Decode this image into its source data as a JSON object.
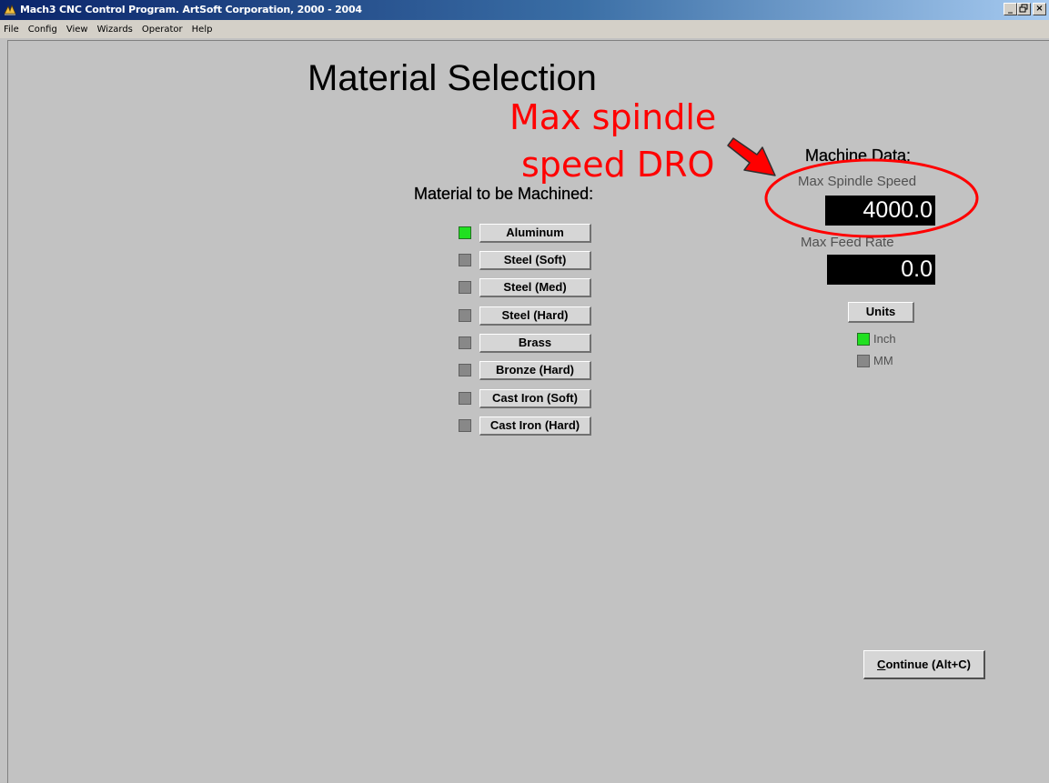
{
  "window": {
    "title": "Mach3 CNC Control Program. ArtSoft Corporation, 2000 - 2004",
    "controls": {
      "minimize": "_",
      "maximize": " ",
      "close": "×"
    }
  },
  "menu": [
    "File",
    "Config",
    "View",
    "Wizards",
    "Operator",
    "Help"
  ],
  "page": {
    "title": "Material Selection"
  },
  "materials": {
    "header": "Material to be Machined:",
    "items": [
      {
        "label": "Aluminum",
        "selected": true
      },
      {
        "label": "Steel (Soft)",
        "selected": false
      },
      {
        "label": "Steel (Med)",
        "selected": false
      },
      {
        "label": "Steel (Hard)",
        "selected": false
      },
      {
        "label": "Brass",
        "selected": false
      },
      {
        "label": "Bronze (Hard)",
        "selected": false
      },
      {
        "label": "Cast Iron (Soft)",
        "selected": false
      },
      {
        "label": "Cast Iron (Hard)",
        "selected": false
      }
    ]
  },
  "machine": {
    "header": "Machine Data:",
    "max_spindle_label": "Max Spindle Speed",
    "max_spindle_value": "4000.0",
    "max_feed_label": "Max Feed Rate",
    "max_feed_value": "0.0",
    "units_button": "Units",
    "units": [
      {
        "label": "Inch",
        "selected": true
      },
      {
        "label": "MM",
        "selected": false
      }
    ]
  },
  "continue_button": {
    "label_prefix": "C",
    "label_rest": "ontinue (Alt+C)"
  },
  "annotation": {
    "line1": "Max spindle",
    "line2": "speed DRO",
    "color": "#ff0000"
  },
  "colors": {
    "led_on": "#20e020",
    "led_off": "#888888",
    "background": "#c2c2c2"
  }
}
